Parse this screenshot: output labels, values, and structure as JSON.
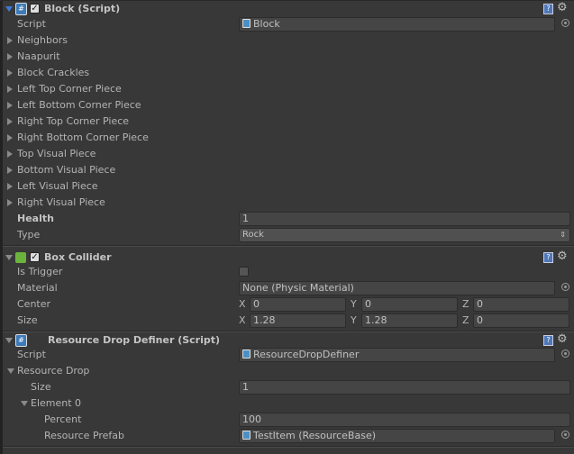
{
  "components": [
    {
      "title": "Block (Script)",
      "icon": "csharp-script-icon",
      "has_enable_checkbox": true,
      "enabled": true,
      "rows": [
        {
          "type": "object",
          "label": "Script",
          "value": "Block"
        },
        {
          "type": "foldout",
          "label": "Neighbors",
          "open": false
        },
        {
          "type": "foldout",
          "label": "Naapurit",
          "open": false
        },
        {
          "type": "foldout",
          "label": "Block Crackles",
          "open": false
        },
        {
          "type": "foldout",
          "label": "Left Top Corner Piece",
          "open": false
        },
        {
          "type": "foldout",
          "label": "Left Bottom Corner Piece",
          "open": false
        },
        {
          "type": "foldout",
          "label": "Right Top Corner Piece",
          "open": false
        },
        {
          "type": "foldout",
          "label": "Right Bottom Corner Piece",
          "open": false
        },
        {
          "type": "foldout",
          "label": "Top Visual Piece",
          "open": false
        },
        {
          "type": "foldout",
          "label": "Bottom Visual Piece",
          "open": false
        },
        {
          "type": "foldout",
          "label": "Left Visual Piece",
          "open": false
        },
        {
          "type": "foldout",
          "label": "Right Visual Piece",
          "open": false
        },
        {
          "type": "text",
          "label": "Health",
          "value": "1",
          "bold": true
        },
        {
          "type": "popup",
          "label": "Type",
          "value": "Rock"
        }
      ]
    },
    {
      "title": "Box Collider",
      "icon": "box-collider-icon",
      "has_enable_checkbox": true,
      "enabled": true,
      "rows": [
        {
          "type": "checkbox",
          "label": "Is Trigger",
          "checked": false
        },
        {
          "type": "object",
          "label": "Material",
          "value": "None (Physic Material)",
          "no_icon": true
        },
        {
          "type": "vector3",
          "label": "Center",
          "x": "0",
          "y": "0",
          "z": "0",
          "axes": [
            "X",
            "Y",
            "Z"
          ]
        },
        {
          "type": "vector3",
          "label": "Size",
          "x": "1.28",
          "y": "1.28",
          "z": "0",
          "axes": [
            "X",
            "Y",
            "Z"
          ]
        }
      ]
    },
    {
      "title": "Resource Drop Definer (Script)",
      "icon": "csharp-script-icon",
      "has_enable_checkbox": false,
      "rows": [
        {
          "type": "object",
          "label": "Script",
          "value": "ResourceDropDefiner"
        },
        {
          "type": "foldout",
          "label": "Resource Drop",
          "open": true
        },
        {
          "type": "text",
          "label": "Size",
          "value": "1",
          "indent": 1
        },
        {
          "type": "foldout",
          "label": "Element 0",
          "open": true,
          "indent": 1
        },
        {
          "type": "text",
          "label": "Percent",
          "value": "100",
          "indent": 2
        },
        {
          "type": "object",
          "label": "Resource Prefab",
          "value": "TestItem (ResourceBase)",
          "indent": 2
        }
      ]
    }
  ],
  "header_icons": {
    "help": "?",
    "gear": "⚙"
  }
}
